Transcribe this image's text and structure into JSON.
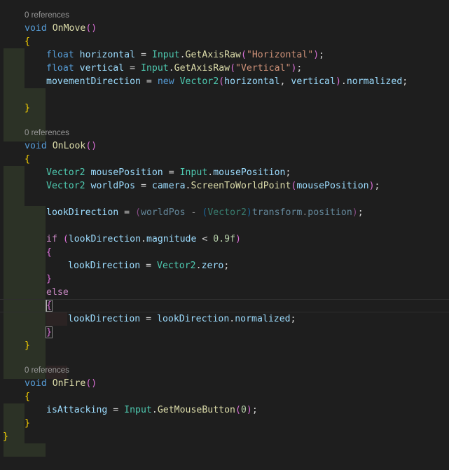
{
  "codelens": {
    "on_move": "0 references",
    "on_look": "0 references",
    "on_fire": "0 references"
  },
  "code": {
    "void": "void",
    "float": "float",
    "new": "new",
    "if": "if",
    "else": "else",
    "on_move": "OnMove",
    "on_look": "OnLook",
    "on_fire": "OnFire",
    "horizontal": "horizontal",
    "vertical": "vertical",
    "input": "Input",
    "get_axis_raw": "GetAxisRaw",
    "str_horizontal": "\"Horizontal\"",
    "str_vertical": "\"Vertical\"",
    "movement_direction": "movementDirection",
    "vector2": "Vector2",
    "normalized": "normalized",
    "mouse_position_var": "mousePosition",
    "mouse_position_prop": "mousePosition",
    "world_pos": "worldPos",
    "camera": "camera",
    "screen_to_world_point": "ScreenToWorldPoint",
    "look_direction": "lookDirection",
    "transform": "transform",
    "position": "position",
    "magnitude": "magnitude",
    "num_09f": "0.9f",
    "zero": "zero",
    "is_attacking": "isAttacking",
    "get_mouse_button": "GetMouseButton",
    "num_0": "0"
  },
  "colors": {
    "background": "#1e1e1e",
    "keyword": "#569cd6",
    "control_keyword": "#c586c0",
    "method": "#dcdcaa",
    "type": "#4ec9b0",
    "variable": "#9cdcfe",
    "string": "#ce9178",
    "number": "#b5cea8",
    "bracket_1": "#ffd700",
    "bracket_2": "#da70d6",
    "bracket_3": "#179fff"
  }
}
